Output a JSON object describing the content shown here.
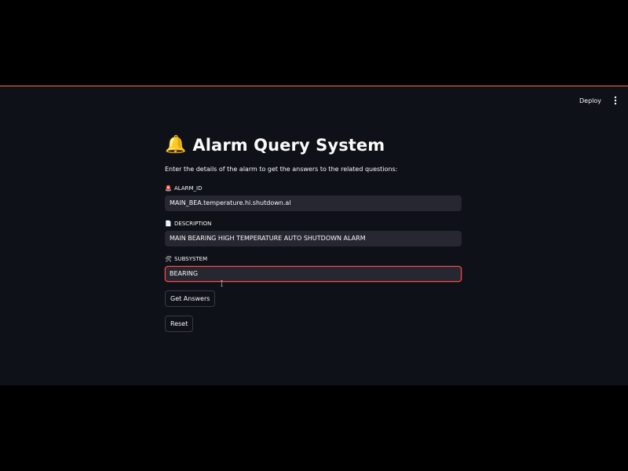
{
  "toolbar": {
    "deploy_label": "Deploy",
    "menu_icon": "kebab-menu-icon"
  },
  "header": {
    "bell_emoji": "🔔",
    "title": "Alarm Query System"
  },
  "intro": {
    "text": "Enter the details of the alarm to get the answers to the related questions:"
  },
  "fields": {
    "alarm_id": {
      "icon": "🚨",
      "label": "ALARM_ID",
      "value": "MAIN_BEA.temperature.hi.shutdown.al"
    },
    "description": {
      "icon": "📄",
      "label": "DESCRIPTION",
      "value": "MAIN BEARING HIGH TEMPERATURE AUTO SHUTDOWN ALARM"
    },
    "subsystem": {
      "icon": "🛠",
      "label": "SUBSYSTEM",
      "value": "BEARING"
    }
  },
  "actions": {
    "get_answers_label": "Get Answers",
    "reset_label": "Reset"
  },
  "colors": {
    "app_bg": "#0e1117",
    "input_bg": "#262730",
    "focus_border": "#ff4b4b",
    "text": "#fafafa",
    "top_accent": "#ff6a3d"
  }
}
